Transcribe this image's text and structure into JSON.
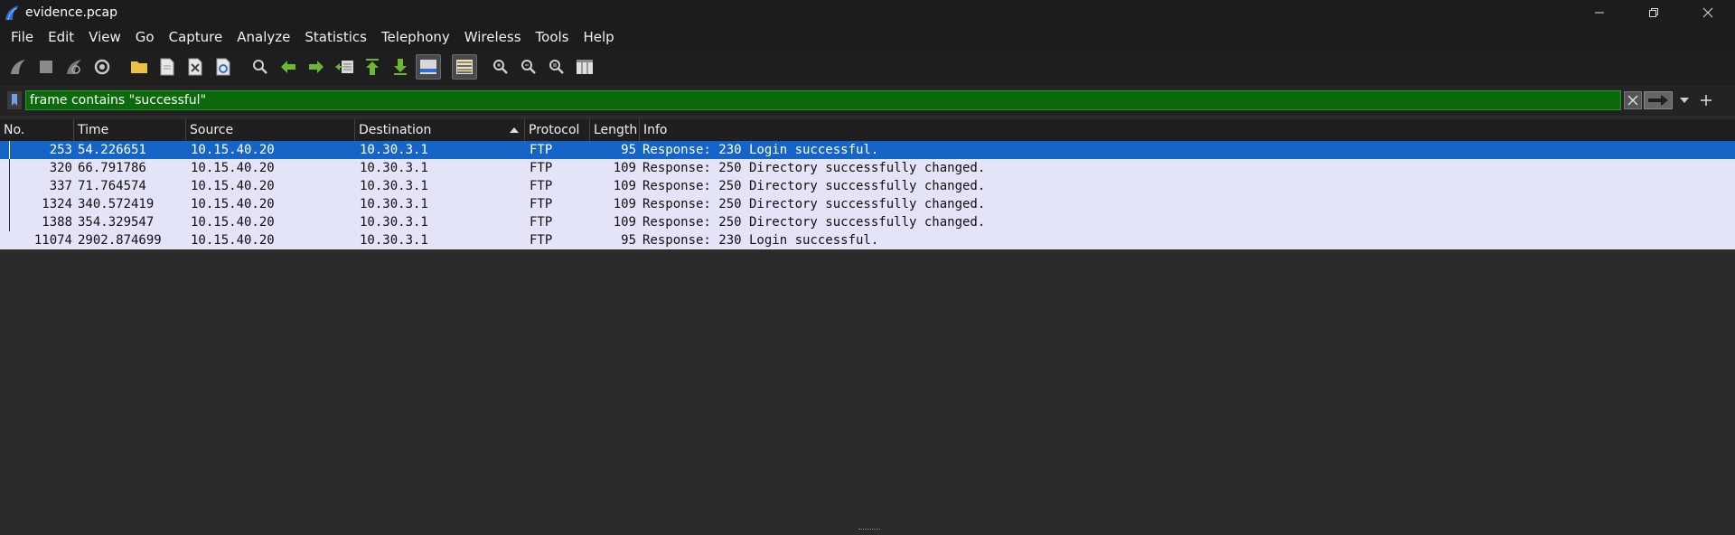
{
  "window": {
    "title": "evidence.pcap"
  },
  "menu": [
    "File",
    "Edit",
    "View",
    "Go",
    "Capture",
    "Analyze",
    "Statistics",
    "Telephony",
    "Wireless",
    "Tools",
    "Help"
  ],
  "toolbar": {
    "buttons": [
      "start-capture",
      "stop-capture",
      "restart-capture",
      "capture-options",
      "open-file",
      "save-file",
      "close-file",
      "reload-file",
      "find-packet",
      "go-back",
      "go-forward",
      "go-to-packet",
      "go-to-first",
      "go-to-last",
      "auto-scroll",
      "colorize",
      "zoom-in",
      "zoom-out",
      "zoom-normal",
      "resize-columns"
    ]
  },
  "filter": {
    "value": "frame contains \"successful\"",
    "color": "#0b6b0b"
  },
  "packet_list": {
    "columns": [
      "No.",
      "Time",
      "Source",
      "Destination",
      "Protocol",
      "Length",
      "Info"
    ],
    "sorted_column": "Destination",
    "rows": [
      {
        "no": "253",
        "time": "54.226651",
        "source": "10.15.40.20",
        "destination": "10.30.3.1",
        "protocol": "FTP",
        "length": "95",
        "info": "Response: 230 Login successful.",
        "selected": true
      },
      {
        "no": "320",
        "time": "66.791786",
        "source": "10.15.40.20",
        "destination": "10.30.3.1",
        "protocol": "FTP",
        "length": "109",
        "info": "Response: 250 Directory successfully changed.",
        "selected": false
      },
      {
        "no": "337",
        "time": "71.764574",
        "source": "10.15.40.20",
        "destination": "10.30.3.1",
        "protocol": "FTP",
        "length": "109",
        "info": "Response: 250 Directory successfully changed.",
        "selected": false
      },
      {
        "no": "1324",
        "time": "340.572419",
        "source": "10.15.40.20",
        "destination": "10.30.3.1",
        "protocol": "FTP",
        "length": "109",
        "info": "Response: 250 Directory successfully changed.",
        "selected": false
      },
      {
        "no": "1388",
        "time": "354.329547",
        "source": "10.15.40.20",
        "destination": "10.30.3.1",
        "protocol": "FTP",
        "length": "109",
        "info": "Response: 250 Directory successfully changed.",
        "selected": false
      },
      {
        "no": "11074",
        "time": "2902.874699",
        "source": "10.15.40.20",
        "destination": "10.30.3.1",
        "protocol": "FTP",
        "length": "95",
        "info": "Response: 230 Login successful.",
        "selected": false
      }
    ]
  },
  "colors": {
    "row_bg": "#e4e4f8",
    "selected_bg": "#1565c8"
  }
}
